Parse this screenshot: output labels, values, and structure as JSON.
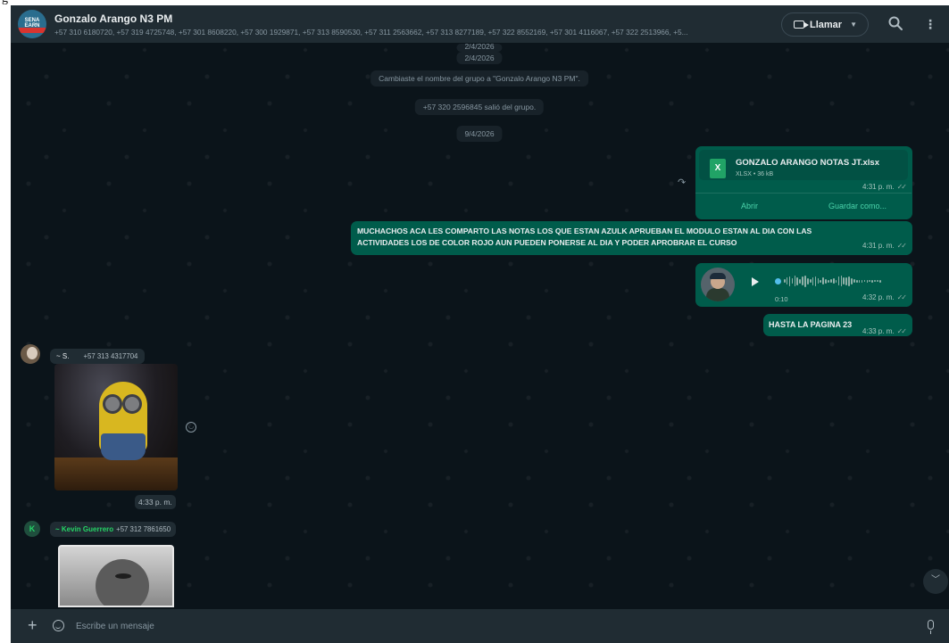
{
  "header": {
    "group_name": "Gonzalo Arango N3 PM",
    "avatar_text": "SENA EARN",
    "members": "+57 310 6180720, +57 319 4725748, +57 301 8608220, +57 300 1929871, +57 313 8590530, +57 311 2563662, +57 313 8277189, +57 322 8552169, +57 301 4116067, +57 322 2513966, +5...",
    "call_label": "Llamar"
  },
  "system": {
    "date_top_cut": "2/4/2026",
    "date_1": "2/4/2026",
    "rename_notice": "Cambiaste el nombre del grupo a \"Gonzalo Arango N3 PM\".",
    "left_notice": "+57 320 2596845 salió del grupo.",
    "date_2": "9/4/2026"
  },
  "messages": {
    "doc": {
      "filename": "GONZALO ARANGO NOTAS JT.xlsx",
      "meta": "XLSX • 36 kB",
      "time": "4:31 p. m.",
      "open_label": "Abrir",
      "save_label": "Guardar como..."
    },
    "text_1": {
      "line_1": "MUCHACHOS ACA LES COMPARTO LAS NOTAS LOS QUE ESTAN AZULK APRUEBAN EL MODULO ESTAN AL DIA CON LAS",
      "line_2": "ACTIVIDADES LOS DE COLOR ROJO AUN PUEDEN PONERSE AL DIA Y PODER APROBRAR EL CURSO",
      "time": "4:31 p. m."
    },
    "voice": {
      "duration": "0:10",
      "time": "4:32 p. m."
    },
    "text_2": {
      "text": "HASTA LA PAGINA 23",
      "time": "4:33 p. m."
    },
    "incoming_1": {
      "sender": "~ S.",
      "phone": "+57 313 4317704",
      "time": "4:33 p. m."
    },
    "incoming_2": {
      "sender": "~ Kevin Guerrero",
      "phone": "+57 312 7861650",
      "avatar_letter": "K"
    }
  },
  "composer": {
    "placeholder": "Escribe un mensaje"
  },
  "colors": {
    "background": "#0b141a",
    "outgoing": "#005c4b",
    "incoming": "#202c33",
    "accent": "#25d366"
  }
}
